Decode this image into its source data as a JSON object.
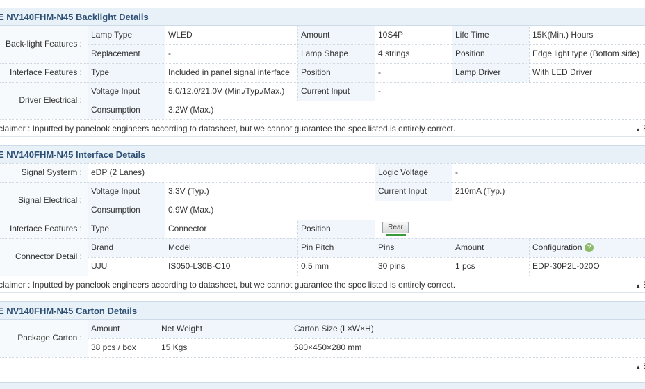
{
  "backlight": {
    "title": "E NV140FHM-N45 Backlight Details",
    "group_backlight": "Back-light Features :",
    "lamp_type_label": "Lamp Type",
    "lamp_type_value": "WLED",
    "amount_label": "Amount",
    "amount_value": "10S4P",
    "life_time_label": "Life Time",
    "life_time_value": "15K(Min.) Hours",
    "replacement_label": "Replacement",
    "replacement_value": "-",
    "lamp_shape_label": "Lamp Shape",
    "lamp_shape_value": "4 strings",
    "position_label": "Position",
    "position_value": "Edge light type (Bottom side)",
    "group_interface": "Interface Features :",
    "type_label": "Type",
    "type_value": "Included in panel signal interface",
    "if_position_label": "Position",
    "if_position_value": "-",
    "lamp_driver_label": "Lamp Driver",
    "lamp_driver_value": "With LED Driver",
    "group_driver": "Driver Electrical :",
    "voltage_input_label": "Voltage Input",
    "voltage_input_value": "5.0/12.0/21.0V (Min./Typ./Max.)",
    "current_input_label": "Current Input",
    "current_input_value": "-",
    "consumption_label": "Consumption",
    "consumption_value": "3.2W (Max.)",
    "disclaimer": "claimer : Inputted by panelook engineers according to datasheet, but we cannot guarantee the spec listed is entirely correct.",
    "back_label": "B"
  },
  "interface": {
    "title": "E NV140FHM-N45 Interface Details",
    "group_signal_system": "Signal Systerm :",
    "signal_system_value": "eDP (2 Lanes)",
    "logic_voltage_label": "Logic Voltage",
    "logic_voltage_value": "-",
    "group_signal_electrical": "Signal Electrical :",
    "voltage_input_label": "Voltage Input",
    "voltage_input_value": "3.3V (Typ.)",
    "current_input_label": "Current Input",
    "current_input_value": "210mA (Typ.)",
    "consumption_label": "Consumption",
    "consumption_value": "0.9W (Max.)",
    "group_interface": "Interface Features :",
    "type_label": "Type",
    "type_value": "Connector",
    "position_label": "Position",
    "position_button": "Rear",
    "group_connector": "Connector Detail :",
    "brand_label": "Brand",
    "model_label": "Model",
    "pin_pitch_label": "Pin Pitch",
    "pins_label": "Pins",
    "amount_label": "Amount",
    "configuration_label": "Configuration",
    "brand_value": "UJU",
    "model_value": "IS050-L30B-C10",
    "pin_pitch_value": "0.5 mm",
    "pins_value": "30 pins",
    "amount_value": "1 pcs",
    "configuration_value": "EDP-30P2L-020O",
    "help_glyph": "?",
    "disclaimer": "claimer : Inputted by panelook engineers according to datasheet, but we cannot guarantee the spec listed is entirely correct.",
    "back_label": "B"
  },
  "carton": {
    "title": "E NV140FHM-N45 Carton Details",
    "group_package": "Package Carton :",
    "amount_label": "Amount",
    "net_weight_label": "Net Weight",
    "carton_size_label": "Carton Size (L×W×H)",
    "amount_value": "38 pcs / box",
    "net_weight_value": "15 Kgs",
    "carton_size_value": "580×450×280 mm",
    "back_label": "B"
  },
  "colors": {
    "header_bg": "#e9f1f8",
    "header_text": "#2c4f74",
    "label_bg": "#f0f6fb",
    "border": "#cfd8e0"
  }
}
